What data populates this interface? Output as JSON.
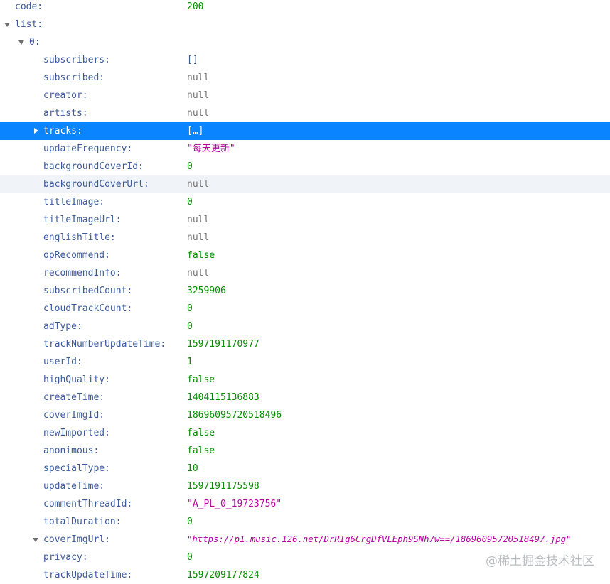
{
  "watermark": "@稀土掘金技术社区",
  "rows": [
    {
      "key": "code:",
      "value": "200",
      "type": "number"
    },
    {
      "key": "list:",
      "value": "",
      "type": "none"
    },
    {
      "key": "0:",
      "value": "",
      "type": "none"
    },
    {
      "key": "subscribers:",
      "value": "[]",
      "type": "bracket"
    },
    {
      "key": "subscribed:",
      "value": "null",
      "type": "null"
    },
    {
      "key": "creator:",
      "value": "null",
      "type": "null"
    },
    {
      "key": "artists:",
      "value": "null",
      "type": "null"
    },
    {
      "key": "tracks:",
      "value": "[…]",
      "type": "bracket"
    },
    {
      "key": "updateFrequency:",
      "value": "\"每天更新\"",
      "type": "string"
    },
    {
      "key": "backgroundCoverId:",
      "value": "0",
      "type": "number"
    },
    {
      "key": "backgroundCoverUrl:",
      "value": "null",
      "type": "null"
    },
    {
      "key": "titleImage:",
      "value": "0",
      "type": "number"
    },
    {
      "key": "titleImageUrl:",
      "value": "null",
      "type": "null"
    },
    {
      "key": "englishTitle:",
      "value": "null",
      "type": "null"
    },
    {
      "key": "opRecommend:",
      "value": "false",
      "type": "bool"
    },
    {
      "key": "recommendInfo:",
      "value": "null",
      "type": "null"
    },
    {
      "key": "subscribedCount:",
      "value": "3259906",
      "type": "number"
    },
    {
      "key": "cloudTrackCount:",
      "value": "0",
      "type": "number"
    },
    {
      "key": "adType:",
      "value": "0",
      "type": "number"
    },
    {
      "key": "trackNumberUpdateTime:",
      "value": "1597191170977",
      "type": "number"
    },
    {
      "key": "userId:",
      "value": "1",
      "type": "number"
    },
    {
      "key": "highQuality:",
      "value": "false",
      "type": "bool"
    },
    {
      "key": "createTime:",
      "value": "1404115136883",
      "type": "number"
    },
    {
      "key": "coverImgId:",
      "value": "18696095720518496",
      "type": "number"
    },
    {
      "key": "newImported:",
      "value": "false",
      "type": "bool"
    },
    {
      "key": "anonimous:",
      "value": "false",
      "type": "bool"
    },
    {
      "key": "specialType:",
      "value": "10",
      "type": "number"
    },
    {
      "key": "updateTime:",
      "value": "1597191175598",
      "type": "number"
    },
    {
      "key": "commentThreadId:",
      "value": "\"A_PL_0_19723756\"",
      "type": "string"
    },
    {
      "key": "totalDuration:",
      "value": "0",
      "type": "number"
    },
    {
      "key": "coverImgUrl:",
      "value": "\"https://p1.music.126.net/DrRIg6CrgDfVLEph9SNh7w==/18696095720518497.jpg\"",
      "type": "url"
    },
    {
      "key": "privacy:",
      "value": "0",
      "type": "number"
    },
    {
      "key": "trackUpdateTime:",
      "value": "1597209177824",
      "type": "number"
    }
  ]
}
